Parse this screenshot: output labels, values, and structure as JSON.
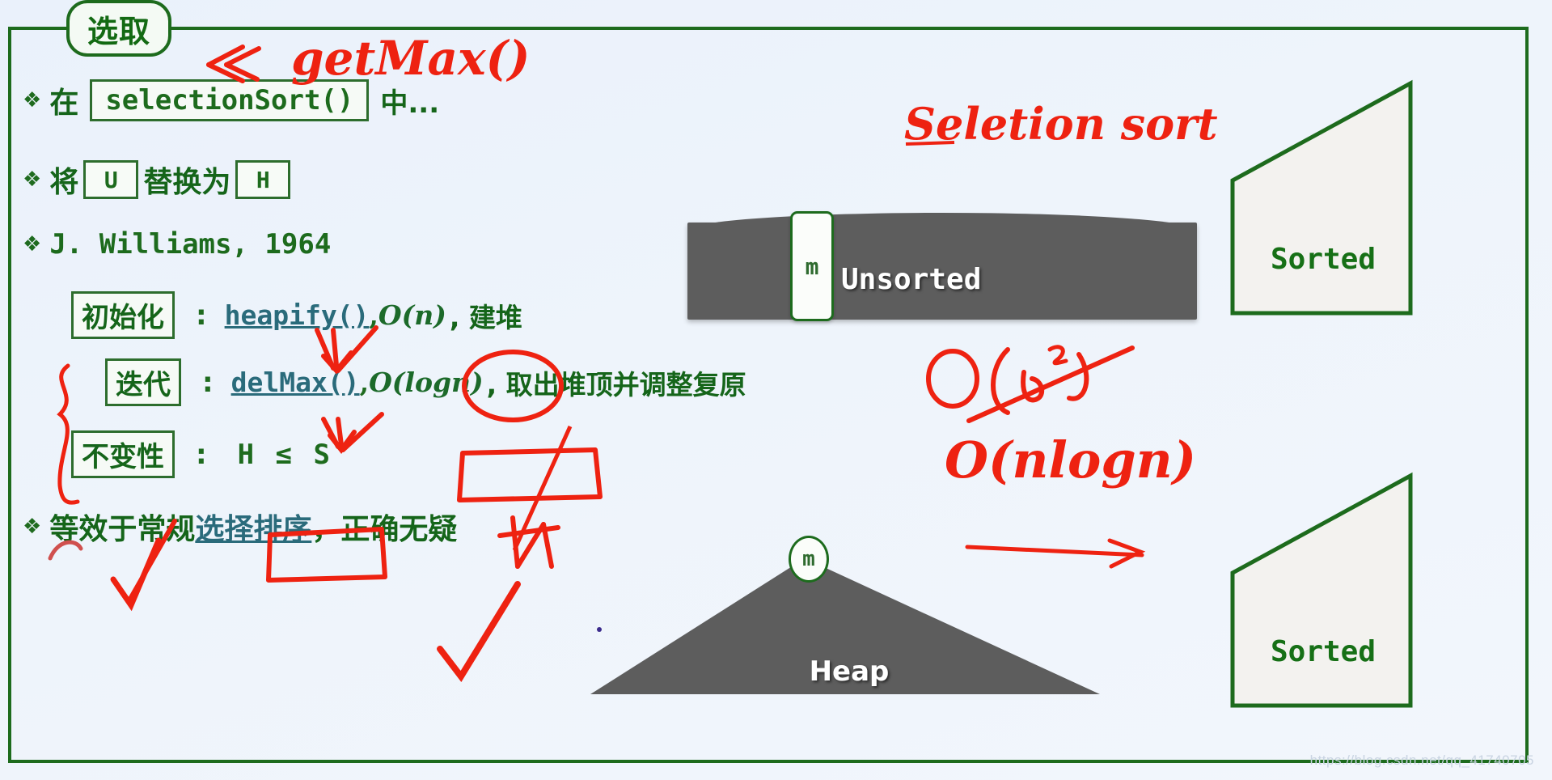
{
  "slide": {
    "title_badge": "选取",
    "watermark": "https://blog.csdn.net/qq_41740705"
  },
  "bullets": {
    "mark": "❖",
    "row1": {
      "prefix": "在",
      "code": "selectionSort()",
      "suffix": "中..."
    },
    "row2": {
      "prefix": "将",
      "from": "U",
      "middle": "替换为",
      "to": "H"
    },
    "row3": {
      "text": "J. Williams, 1964"
    },
    "definitions": [
      {
        "tag": "初始化",
        "colon": ":",
        "func": "heapify()",
        "sep": ",",
        "complexity": "O(n)",
        "note": ", 建堆"
      },
      {
        "tag": "迭代",
        "colon": ":",
        "func": "delMax()",
        "sep": ",",
        "complexity": "O(logn)",
        "note": ", 取出堆顶并调整复原"
      },
      {
        "tag": "不变性",
        "colon": ":",
        "func": "",
        "sep": "",
        "complexity": "H ≤ S",
        "note": ""
      }
    ],
    "row_last": {
      "prefix": "等效于常规",
      "link": "选择排序",
      "suffix": "，正确无疑"
    }
  },
  "diagram": {
    "unsorted_label": "Unsorted",
    "m_cell": "m",
    "sorted_top_label": "Sorted",
    "sorted_bottom_label": "Sorted",
    "heap_label": "Heap",
    "heap_m_node": "m"
  },
  "annotations": {
    "get_max": "getMax()",
    "selection_sort": "Seletion sort",
    "big_o_n2": "O(n²)",
    "big_o_nlogn": "O(nlogn)"
  },
  "colors": {
    "slide_bg": "#eef4fb",
    "green": "#1d6b1d",
    "dark_green_text": "#15651a",
    "link_teal": "#2a6b7b",
    "ink_red": "#ee2211",
    "bar_gray": "#5d5d5d"
  }
}
